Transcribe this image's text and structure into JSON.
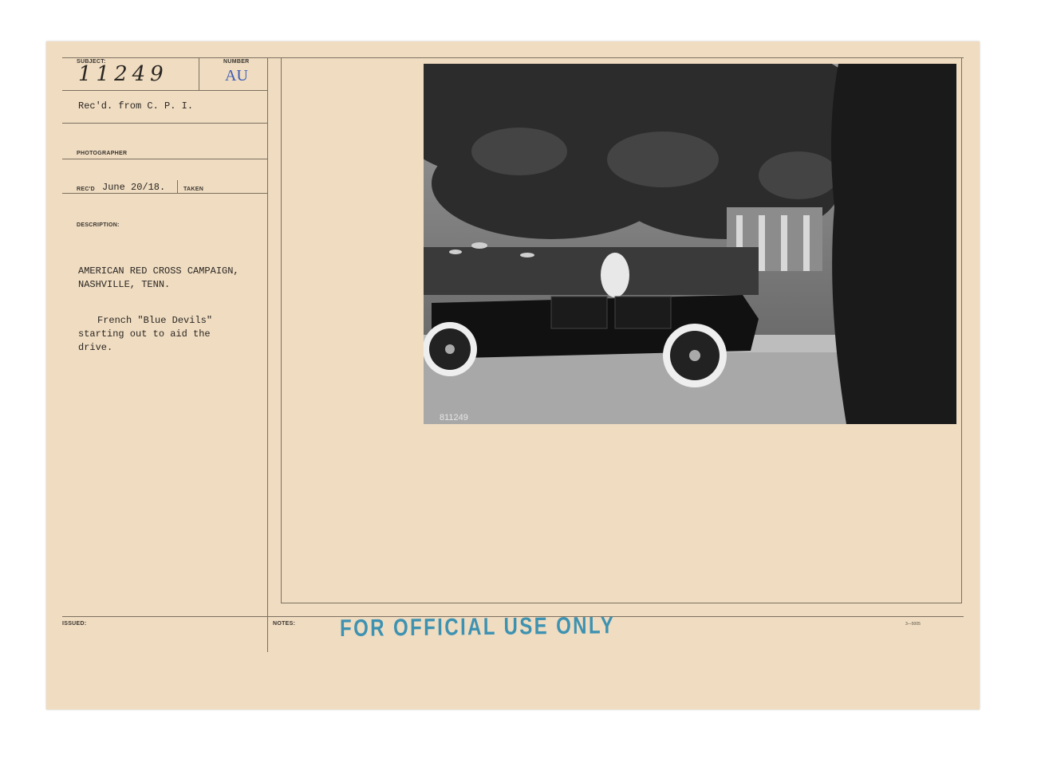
{
  "card": {
    "subject_label": "SUBJECT:",
    "subject_value": "11249",
    "number_label": "NUMBER",
    "number_value": "AU",
    "received_from": "Rec'd. from C. P. I.",
    "photographer_label": "PHOTOGRAPHER",
    "recd_label": "REC'D",
    "recd_date": "June 20/18.",
    "taken_label": "TAKEN",
    "description_label": "DESCRIPTION:",
    "description_line1": "AMERICAN RED CROSS CAMPAIGN,",
    "description_line2": "NASHVILLE, TENN.",
    "caption_line1": "French \"Blue Devils\"",
    "caption_line2": "starting out to aid the",
    "caption_line3": "drive.",
    "issued_label": "ISSUED:",
    "notes_label": "NOTES:",
    "form_code": "3—5005",
    "stamp_text": "FOR OFFICIAL USE ONLY"
  },
  "photo": {
    "negative_number": "811249"
  },
  "colors": {
    "card": "#efdcc1",
    "stamp_blue": "#2b8ab0",
    "au_stamp": "#3d5cb8"
  }
}
